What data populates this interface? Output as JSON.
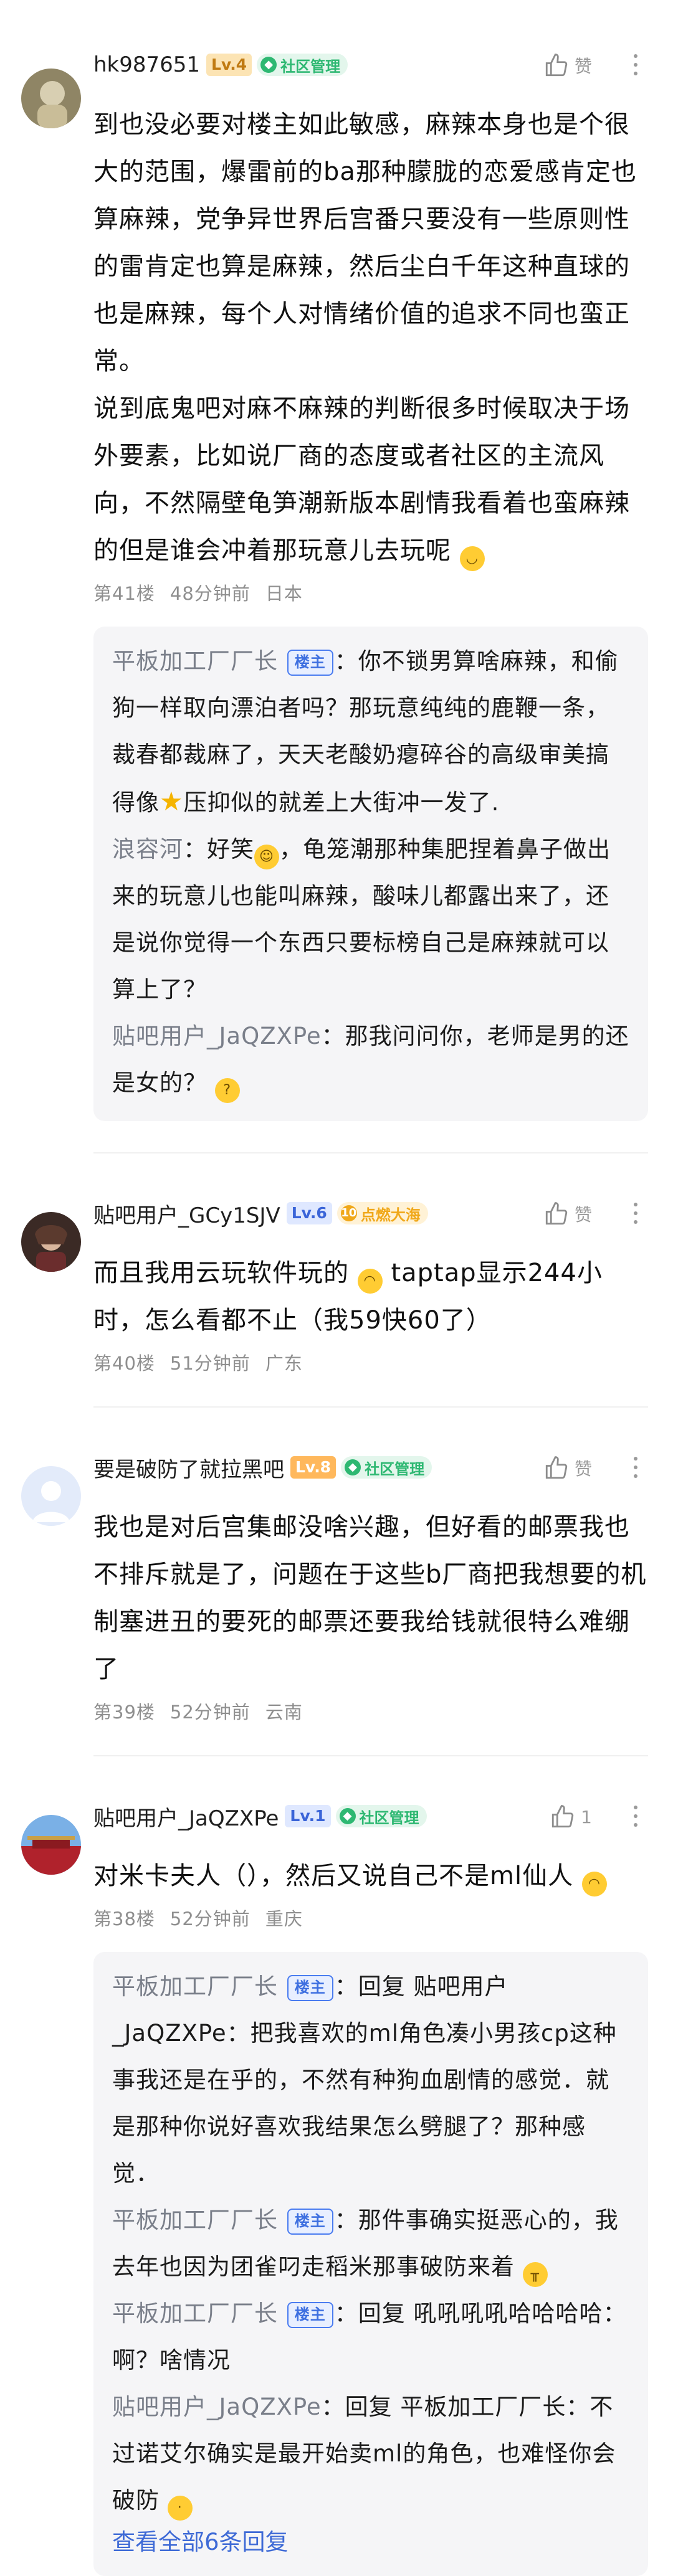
{
  "posts": [
    {
      "user": "hk987651",
      "level": "Lv.4",
      "level_bg": "#fce4b4",
      "level_color": "#c07a12",
      "role": "社区管理",
      "role_color": "#2eb872",
      "like": "赞",
      "body": "到也没必要对楼主如此敏感，麻辣本身也是个很大的范围，爆雷前的ba那种朦胧的恋爱感肯定也算麻辣，党争异世界后宫番只要没有一些原则性的雷肯定也算是麻辣，然后尘白千年这种直球的也是麻辣，每个人对情绪价值的追求不同也蛮正常。\n说到底鬼吧对麻不麻辣的判断很多时候取决于场外要素，比如说厂商的态度或者社区的主流风向，不然隔壁龟笋潮新版本剧情我看着也蛮麻辣的但是谁会冲着那玩意儿去玩呢",
      "floor": "第41楼",
      "time": "48分钟前",
      "loc": "日本",
      "replies": [
        {
          "user": "平板加工厂厂长",
          "badge": "楼主",
          "text": "你不锁男算啥麻辣，和偷狗一样取向漂泊者吗？那玩意纯纯的鹿鞭一条，裁春都裁麻了，天天老酸奶瘪碎谷的高级审美搞得像",
          "text2": "压抑似的就差上大街冲一发了."
        },
        {
          "user": "浪容河",
          "text": "好笑",
          "text2": "，龟笼潮那种集肥捏着鼻子做出来的玩意儿也能叫麻辣，酸味儿都露出来了，还是说你觉得一个东西只要标榜自己是麻辣就可以算上了？"
        },
        {
          "user": "贴吧用户_JaQZXPe",
          "text": "那我问问你，老师是男的还是女的？"
        }
      ]
    },
    {
      "user": "贴吧用户_GCy1SJV",
      "level": "Lv.6",
      "level_bg": "#dfe8ff",
      "level_color": "#3a64d8",
      "role": "点燃大海",
      "role_color": "#f0a81a",
      "like": "赞",
      "body": "而且我用云玩软件玩的",
      "body2": "taptap显示244小时，怎么看都不止（我59快60了）",
      "floor": "第40楼",
      "time": "51分钟前",
      "loc": "广东"
    },
    {
      "user": "要是破防了就拉黑吧",
      "level": "Lv.8",
      "level_bg": "#ffb85c",
      "level_color": "#ffffff",
      "role": "社区管理",
      "role_color": "#2eb872",
      "like": "赞",
      "body": "我也是对后宫集邮没啥兴趣，但好看的邮票我也不排斥就是了，问题在于这些b厂商把我想要的机制塞进丑的要死的邮票还要我给钱就很特么难绷了",
      "floor": "第39楼",
      "time": "52分钟前",
      "loc": "云南"
    },
    {
      "user": "贴吧用户_JaQZXPe",
      "level": "Lv.1",
      "level_bg": "#dfe8ff",
      "level_color": "#3a64d8",
      "role": "社区管理",
      "role_color": "#2eb872",
      "like": "1",
      "body": "对米卡夫人（），然后又说自己不是ml仙人",
      "floor": "第38楼",
      "time": "52分钟前",
      "loc": "重庆",
      "replies": [
        {
          "user": "平板加工厂厂长",
          "badge": "楼主",
          "text": "回复 贴吧用户_JaQZXPe：把我喜欢的ml角色凑小男孩cp这种事我还是在乎的，不然有种狗血剧情的感觉．就是那种你说好喜欢我结果怎么劈腿了？那种感觉．"
        },
        {
          "user": "平板加工厂厂长",
          "badge": "楼主",
          "text": "那件事确实挺恶心的，我去年也因为团雀叼走稻米那事破防来着"
        },
        {
          "user": "平板加工厂厂长",
          "badge": "楼主",
          "text": "回复 吼吼吼吼哈哈哈哈：啊？啥情况"
        },
        {
          "user": "贴吧用户_JaQZXPe",
          "text": "回复 平板加工厂厂长：不过诺艾尔确实是最开始卖ml的角色，也难怪你会破防"
        }
      ],
      "view_all": "查看全部6条回复"
    }
  ],
  "colors": {
    "accent": "#3e6ad6",
    "meta": "#8f8f8f",
    "reply_bg": "#f5f5f7"
  }
}
